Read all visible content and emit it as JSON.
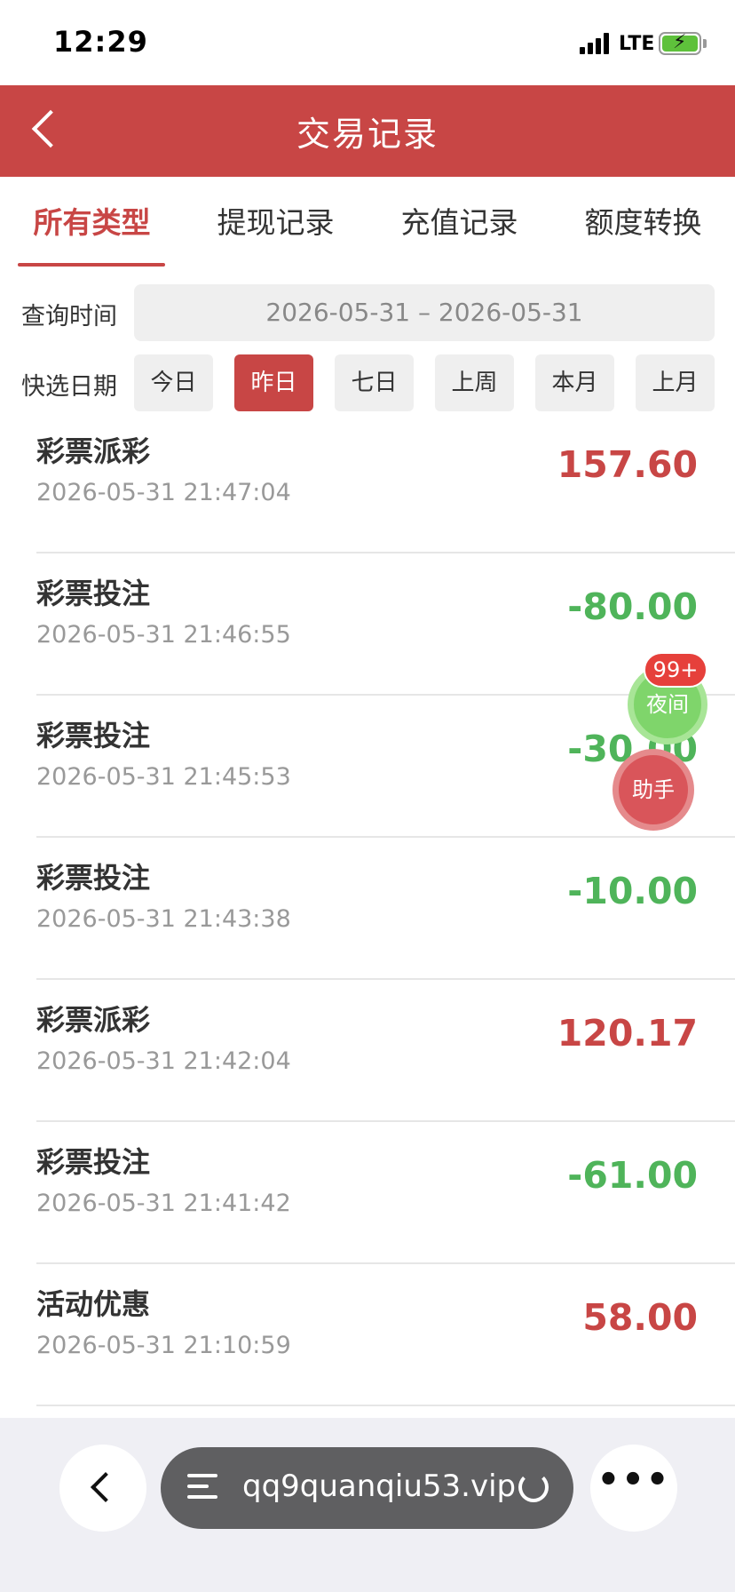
{
  "status_bar": {
    "time": "12:29",
    "network": "LTE"
  },
  "header": {
    "title": "交易记录"
  },
  "tabs": [
    {
      "label": "所有类型",
      "active": true
    },
    {
      "label": "提现记录",
      "active": false
    },
    {
      "label": "充值记录",
      "active": false
    },
    {
      "label": "额度转换",
      "active": false
    }
  ],
  "query": {
    "time_label": "查询时间",
    "date_range": "2026-05-31 – 2026-05-31",
    "quick_label": "快选日期",
    "quick_options": [
      {
        "label": "今日",
        "active": false
      },
      {
        "label": "昨日",
        "active": true
      },
      {
        "label": "七日",
        "active": false
      },
      {
        "label": "上周",
        "active": false
      },
      {
        "label": "本月",
        "active": false
      },
      {
        "label": "上月",
        "active": false
      }
    ]
  },
  "records": [
    {
      "type": "彩票派彩",
      "time": "2026-05-31 21:47:04",
      "amount": "157.60",
      "sign": "positive"
    },
    {
      "type": "彩票投注",
      "time": "2026-05-31 21:46:55",
      "amount": "-80.00",
      "sign": "negative"
    },
    {
      "type": "彩票投注",
      "time": "2026-05-31 21:45:53",
      "amount": "-30.00",
      "sign": "negative"
    },
    {
      "type": "彩票投注",
      "time": "2026-05-31 21:43:38",
      "amount": "-10.00",
      "sign": "negative"
    },
    {
      "type": "彩票派彩",
      "time": "2026-05-31 21:42:04",
      "amount": "120.17",
      "sign": "positive"
    },
    {
      "type": "彩票投注",
      "time": "2026-05-31 21:41:42",
      "amount": "-61.00",
      "sign": "negative"
    },
    {
      "type": "活动优惠",
      "time": "2026-05-31 21:10:59",
      "amount": "58.00",
      "sign": "positive"
    }
  ],
  "floating": {
    "night_label": "夜间",
    "badge": "99+",
    "helper_label": "助手"
  },
  "browser": {
    "url": "qq9quanqiu53.vip",
    "more_label": "•••"
  },
  "colors": {
    "brand_red": "#c84645",
    "positive": "#c84645",
    "negative": "#4fb45a"
  }
}
